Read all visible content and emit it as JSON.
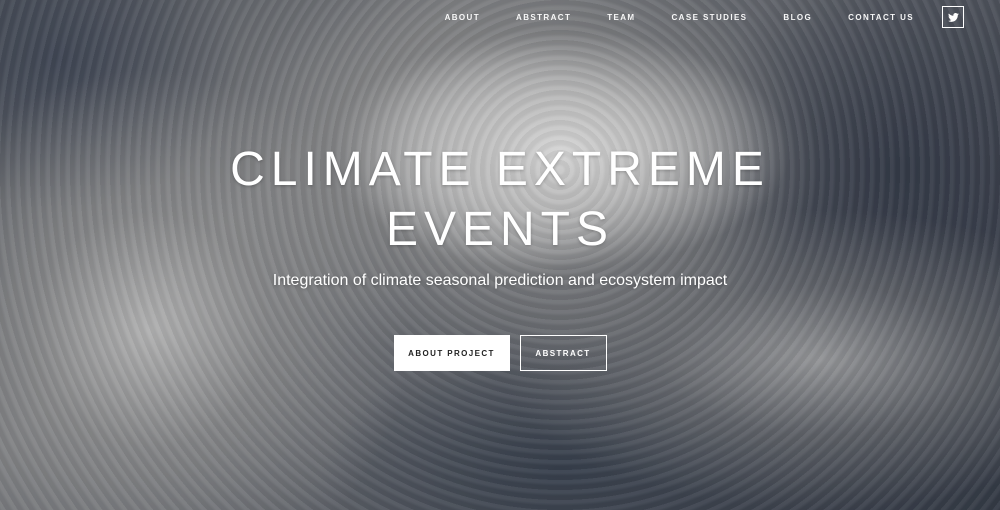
{
  "nav": {
    "items": [
      {
        "label": "ABOUT"
      },
      {
        "label": "ABSTRACT"
      },
      {
        "label": "TEAM"
      },
      {
        "label": "CASE STUDIES"
      },
      {
        "label": "BLOG"
      },
      {
        "label": "CONTACT US"
      }
    ],
    "social_icon": "twitter-icon"
  },
  "hero": {
    "title_line1": "CLIMATE EXTREME",
    "title_line2": "EVENTS",
    "subtitle": "Integration of climate seasonal prediction and ecosystem impact",
    "primary_button": "ABOUT PROJECT",
    "secondary_button": "ABSTRACT",
    "background": "satellite-hurricane-image"
  },
  "colors": {
    "text": "#ffffff",
    "primary_button_bg": "#ffffff",
    "primary_button_text": "#222222"
  }
}
